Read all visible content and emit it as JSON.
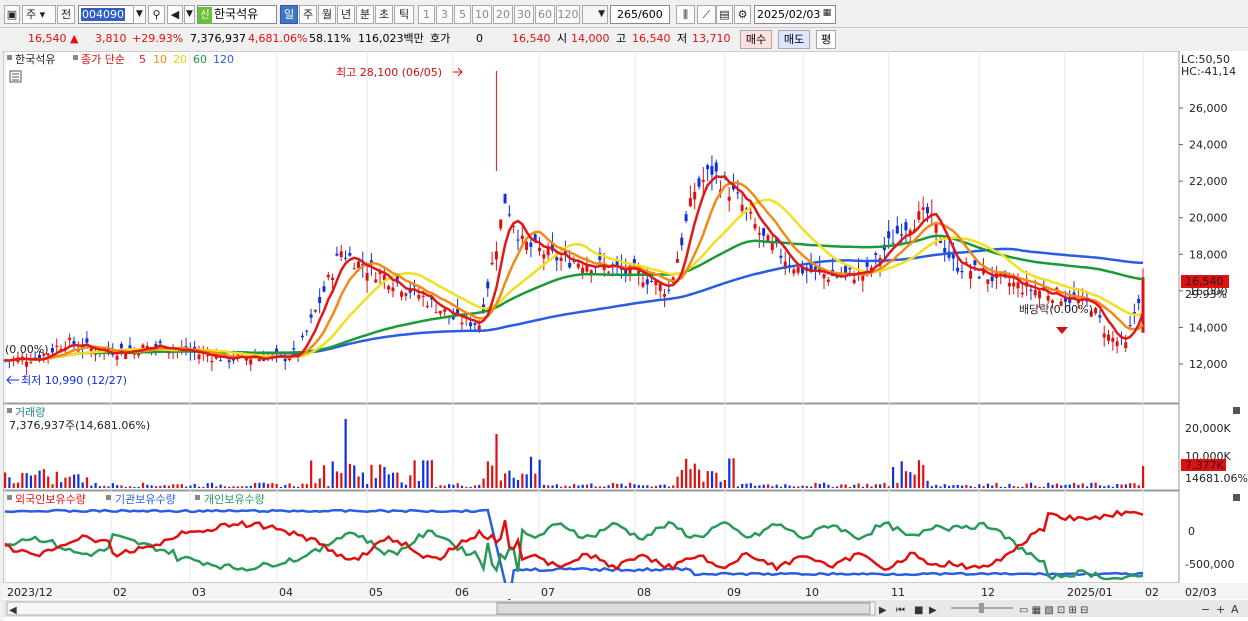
{
  "toolbar": {
    "market_type": "주",
    "prev_label": "전",
    "code": "004090",
    "stock_name": "한국석유",
    "shin_badge": "신",
    "periods": [
      "일",
      "주",
      "월",
      "년",
      "분",
      "초",
      "틱"
    ],
    "active_period": "일",
    "intervals": [
      "1",
      "3",
      "5",
      "10",
      "20",
      "30",
      "60",
      "120"
    ],
    "count": "265",
    "count_max": "/600",
    "date": "2025/02/03"
  },
  "quote": {
    "price": "16,540",
    "change": "3,810",
    "change_pct": "+29.93%",
    "volume": "7,376,937",
    "volume_pct": "4,681.06%",
    "turnover_pct": "58.11%",
    "amount": "116,023백만",
    "hoga_label": "호가",
    "hoga_value": "0",
    "hoga_price": "16,540",
    "open_label": "시",
    "open": "14,000",
    "high_label": "고",
    "high": "16,540",
    "low_label": "저",
    "low": "13,710",
    "buy_label": "매수",
    "sell_label": "매도",
    "avg_label": "평"
  },
  "price_panel": {
    "legend_name": "한국석유",
    "legend_series": "종가 단순",
    "ma_labels": [
      "5",
      "10",
      "20",
      "60",
      "120"
    ],
    "lc_label": "LC:50,50",
    "hc_label": "HC:-41,14",
    "high_annotation": "최고 28,100 (06/05)",
    "low_annotation": "최저 10,990 (12/27)",
    "left_pct": "(0.00%)",
    "dividend_annotation": "배당락(0.00%)",
    "current_price_tag": "16,540",
    "current_pct_tag": "29.93%",
    "y_ticks": [
      "26,000",
      "24,000",
      "22,000",
      "20,000",
      "18,000",
      "16,000",
      "14,000",
      "12,000"
    ]
  },
  "volume_panel": {
    "title": "거래량",
    "subtitle": "7,376,937주(14,681.06%)",
    "y_ticks": [
      "20,000K",
      "10,000K"
    ],
    "tag_value": "7,377K",
    "tag_pct": "14681.06%"
  },
  "holding_panel": {
    "series": [
      "외국인보유수량",
      "기관보유수량",
      "개인보유수량"
    ],
    "y_ticks": [
      "0",
      "-500,000"
    ]
  },
  "x_axis": {
    "labels": [
      "2023/12",
      "02",
      "03",
      "04",
      "05",
      "06",
      "07",
      "08",
      "09",
      "10",
      "11",
      "12",
      "2025/01",
      "02",
      "02/03"
    ]
  },
  "colors": {
    "ma5": "#e01818",
    "ma10": "#f08a18",
    "ma20": "#f0e020",
    "ma60": "#1a9a3a",
    "ma120": "#2a5ee0",
    "up": "#e01010",
    "down": "#1030e0",
    "foreign": "#e01010",
    "institution": "#2a5ee0",
    "retail": "#2a9a5a"
  }
}
